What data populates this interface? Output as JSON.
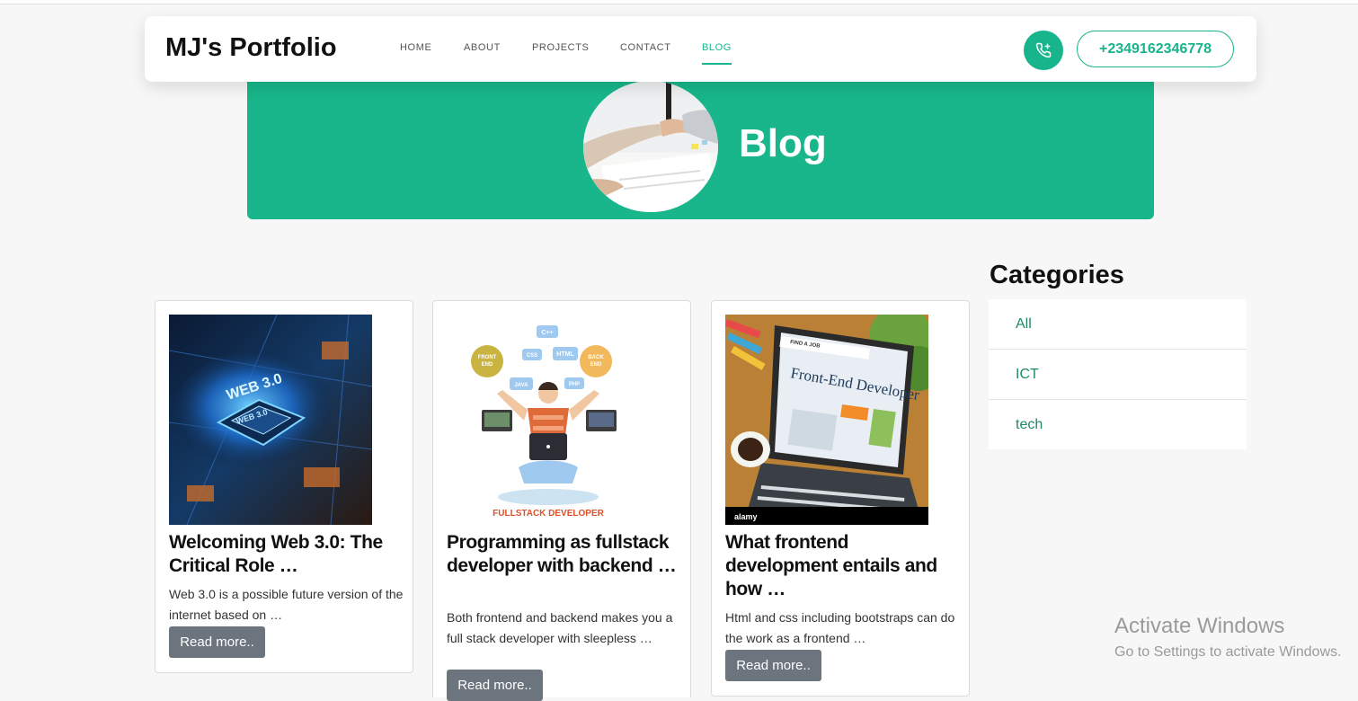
{
  "brand": "MJ's Portfolio",
  "nav": {
    "items": [
      {
        "label": "HOME"
      },
      {
        "label": "ABOUT"
      },
      {
        "label": "PROJECTS"
      },
      {
        "label": "CONTACT"
      },
      {
        "label": "BLOG",
        "active": true
      }
    ],
    "phone_icon": "phone-icon",
    "phone_number": "+2349162346778"
  },
  "hero": {
    "title": "Blog",
    "image": "handshake-photo"
  },
  "posts": [
    {
      "title": "Welcoming Web 3.0: The Critical Role …",
      "excerpt": "Web 3.0 is a possible future version of the internet based on …",
      "button": "Read more..",
      "image_text": [
        "WEB 3.0",
        "WEB 3.0"
      ]
    },
    {
      "title": "Programming as fullstack developer with backend …",
      "excerpt": "Both frontend and backend makes you a full stack developer with sleepless …",
      "button": "Read more..",
      "image_text": [
        "C++",
        "FRONT",
        "END",
        "CSS",
        "HTML",
        "BACK",
        "END",
        "JAVA",
        "PHP",
        "FULLSTACK DEVELOPER"
      ]
    },
    {
      "title": "What frontend development entails and how …",
      "excerpt": "Html and css including bootstraps can do the work as a frontend …",
      "button": "Read more..",
      "image_text": [
        "FIND A JOB",
        "Front-End Developer",
        "alamy"
      ]
    }
  ],
  "categories": {
    "heading": "Categories",
    "items": [
      "All",
      "ICT",
      "tech"
    ]
  },
  "watermark": {
    "title": "Activate Windows",
    "subtitle": "Go to Settings to activate Windows."
  },
  "colors": {
    "accent": "#18b48b",
    "button_gray": "#6c757d",
    "category_text": "#1f8a63"
  }
}
